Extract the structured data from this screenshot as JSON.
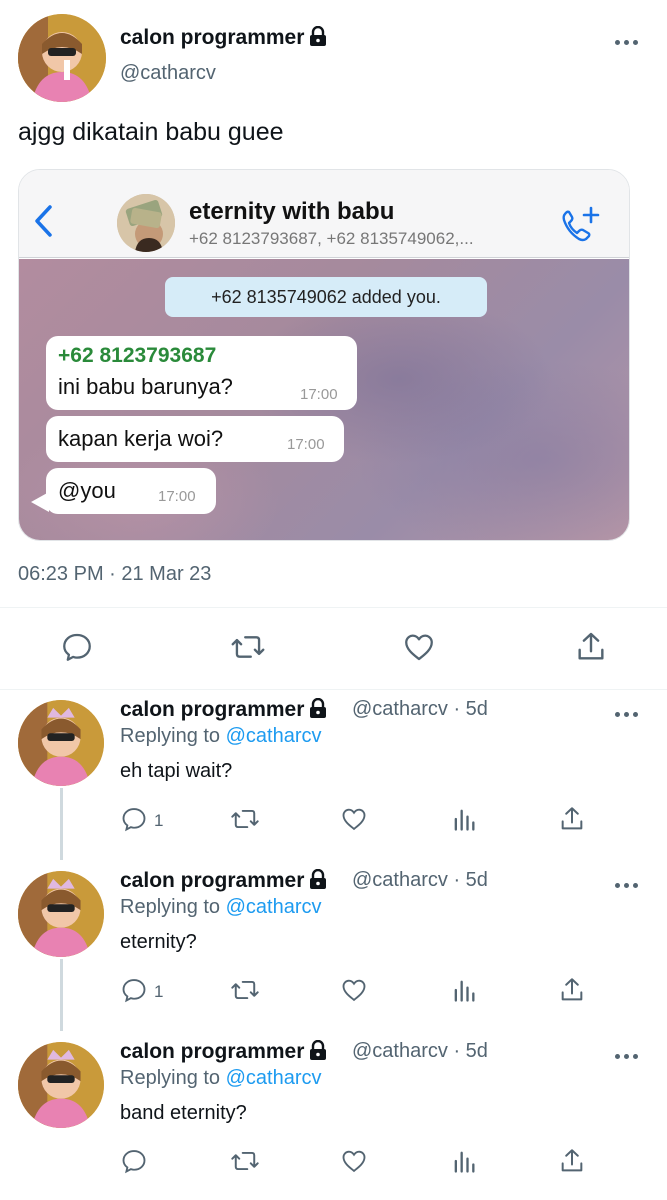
{
  "main_tweet": {
    "display_name": "calon programmer",
    "handle": "@catharcv",
    "text": "ajgg dikatain babu guee",
    "timestamp": "06:23 PM · 21 Mar 23"
  },
  "embedded_chat": {
    "group_name": "eternity with babu",
    "members": "+62 8123793687, +62 8135749062,...",
    "system_message": "+62 8135749062 added you.",
    "messages": [
      {
        "sender": "+62 8123793687",
        "text": "ini babu barunya?",
        "time": "17:00"
      },
      {
        "text": "kapan kerja woi?",
        "time": "17:00"
      },
      {
        "text": "@you",
        "time": "17:00"
      }
    ]
  },
  "replies": [
    {
      "display_name": "calon programmer",
      "meta": "@catharcv · 5d",
      "replying_prefix": "Replying to ",
      "replying_to": "@catharcv",
      "text": "eh tapi wait?",
      "reply_count": "1"
    },
    {
      "display_name": "calon programmer",
      "meta": "@catharcv · 5d",
      "replying_prefix": "Replying to ",
      "replying_to": "@catharcv",
      "text": "eternity?",
      "reply_count": "1"
    },
    {
      "display_name": "calon programmer",
      "meta": "@catharcv · 5d",
      "replying_prefix": "Replying to ",
      "replying_to": "@catharcv",
      "text": "band eternity?",
      "reply_count": ""
    }
  ],
  "icons": {
    "lock": "lock-icon",
    "more": "more-icon",
    "reply": "reply-icon",
    "retweet": "retweet-icon",
    "like": "like-icon",
    "views": "views-icon",
    "share": "share-icon",
    "back": "back-icon",
    "call": "add-call-icon"
  },
  "colors": {
    "accent": "#1d9bf0",
    "secondary_text": "#536471",
    "whatsapp_blue": "#1a73e8",
    "sender_green": "#2a8a3a"
  }
}
